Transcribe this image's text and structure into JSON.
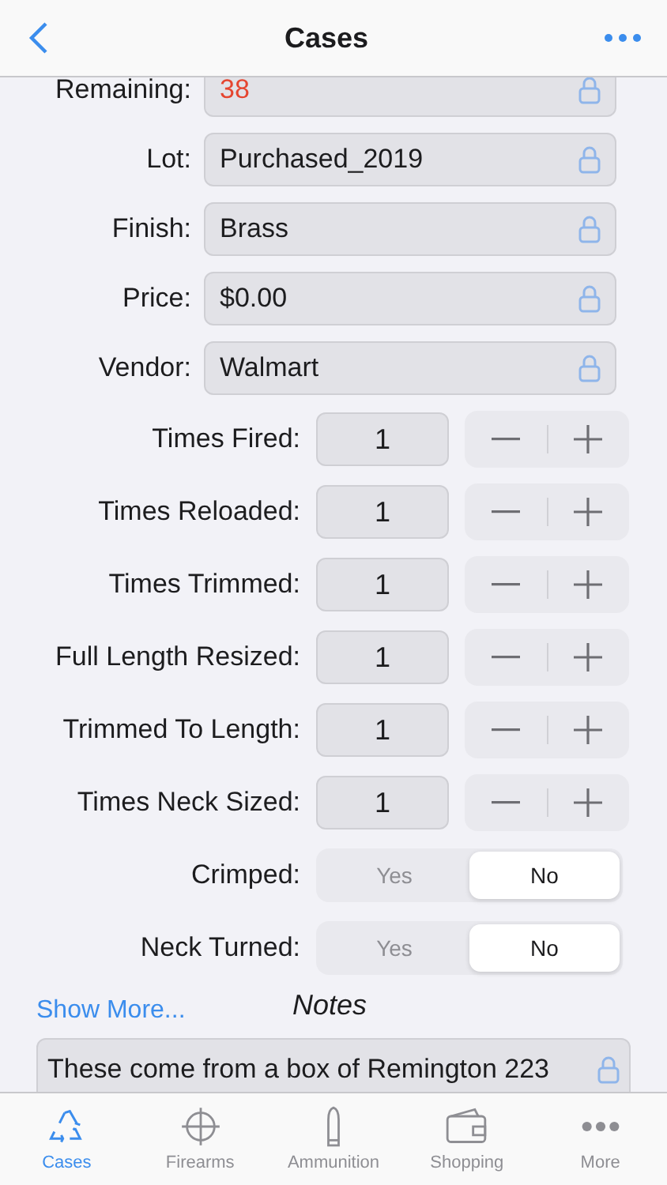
{
  "title": "Cases",
  "fields": [
    {
      "label": "Remaining:",
      "value": "38",
      "color": "#e5452f",
      "locked": true
    },
    {
      "label": "Lot:",
      "value": "Purchased_2019",
      "color": "#1c1c1e",
      "locked": true
    },
    {
      "label": "Finish:",
      "value": "Brass",
      "color": "#1c1c1e",
      "locked": true
    },
    {
      "label": "Price:",
      "value": "$0.00",
      "color": "#1c1c1e",
      "locked": true
    },
    {
      "label": "Vendor:",
      "value": "Walmart",
      "color": "#1c1c1e",
      "locked": true
    }
  ],
  "counters": [
    {
      "label": "Times Fired:",
      "value": "1"
    },
    {
      "label": "Times Reloaded:",
      "value": "1"
    },
    {
      "label": "Times Trimmed:",
      "value": "1"
    },
    {
      "label": "Full Length Resized:",
      "value": "1"
    },
    {
      "label": "Trimmed To Length:",
      "value": "1"
    },
    {
      "label": "Times Neck Sized:",
      "value": "1"
    }
  ],
  "toggles": [
    {
      "label": "Crimped:",
      "options": [
        {
          "label": "Yes",
          "selected": false
        },
        {
          "label": "No",
          "selected": true
        }
      ]
    },
    {
      "label": "Neck Turned:",
      "options": [
        {
          "label": "Yes",
          "selected": false
        },
        {
          "label": "No",
          "selected": true
        }
      ]
    }
  ],
  "show_more": "Show More...",
  "notes": {
    "heading": "Notes",
    "value": "These come from a box of Remington 223",
    "locked": true
  },
  "tabs": [
    {
      "label": "Cases",
      "kind": "recycle",
      "selected": true
    },
    {
      "label": "Firearms",
      "kind": "crosshair",
      "selected": false
    },
    {
      "label": "Ammunition",
      "kind": "cartridge",
      "selected": false
    },
    {
      "label": "Shopping",
      "kind": "wallet",
      "selected": false
    },
    {
      "label": "More",
      "kind": "dots",
      "selected": false
    }
  ]
}
